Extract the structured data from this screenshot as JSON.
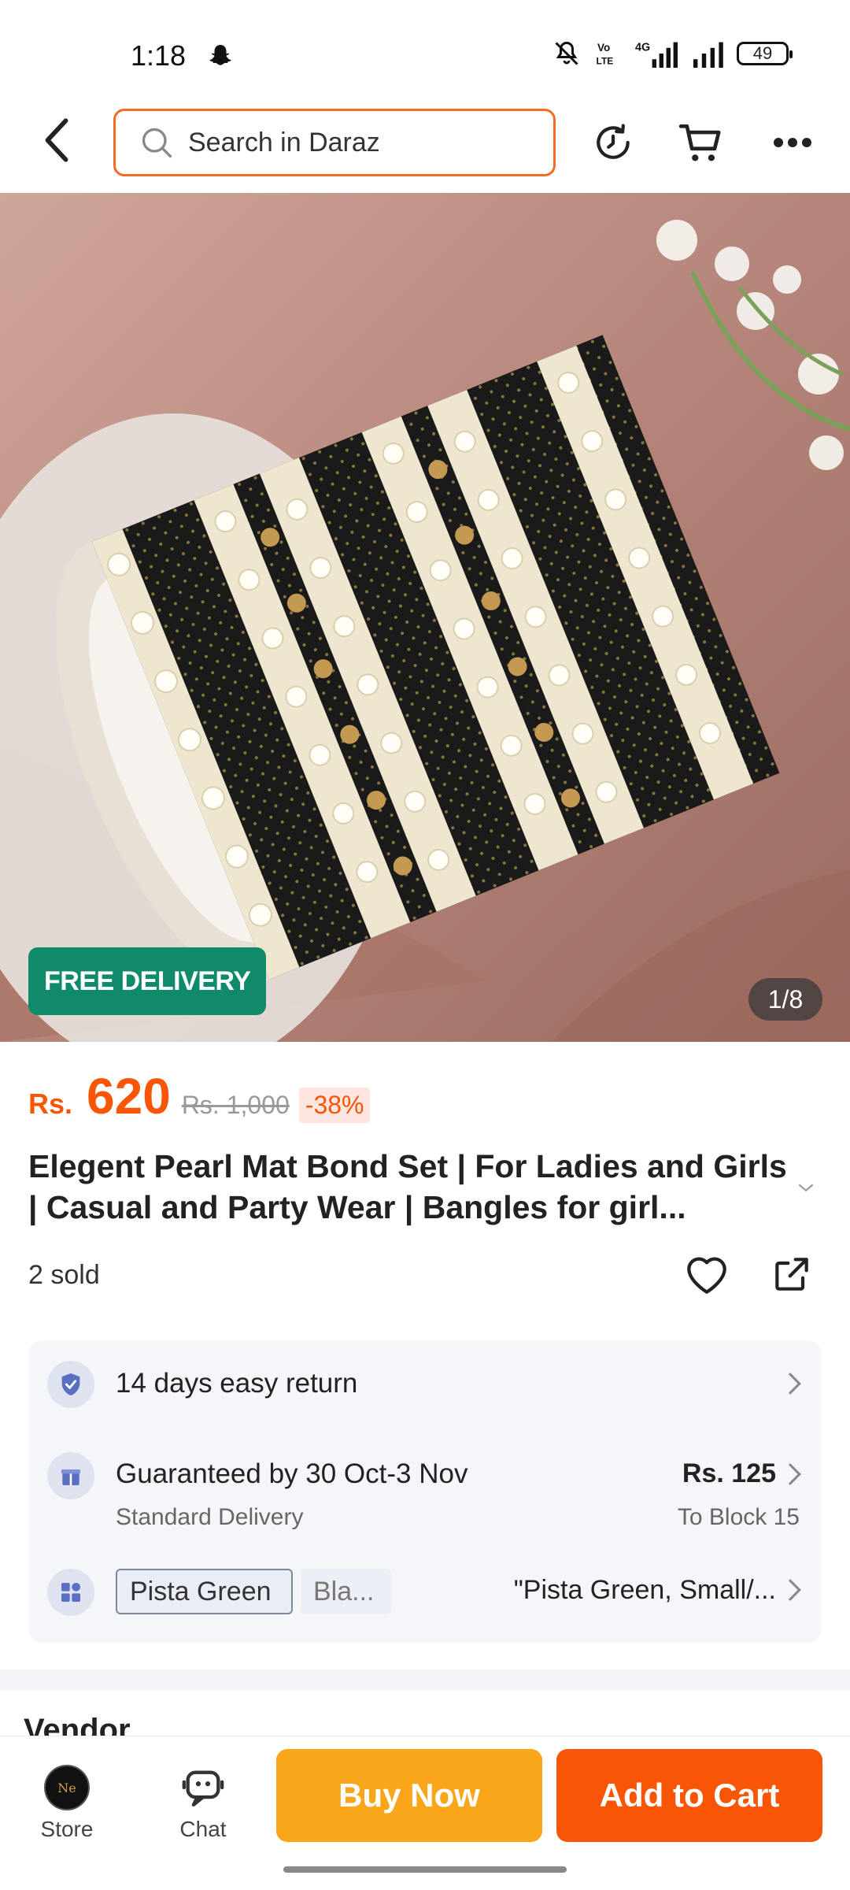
{
  "status_bar": {
    "time": "1:18",
    "battery": "49",
    "icons": [
      "snapchat-icon",
      "mute-icon",
      "volte-icon",
      "signal-4g-icon",
      "signal-icon",
      "battery-icon"
    ]
  },
  "header": {
    "search_placeholder": "Search in Daraz",
    "icons": [
      "back-icon",
      "search-icon",
      "history-icon",
      "cart-icon",
      "more-icon"
    ],
    "accent_color": "#f36c21"
  },
  "gallery": {
    "badge": "FREE DELIVERY",
    "counter": "1/8",
    "current_index": 1,
    "total": 8
  },
  "product": {
    "currency": "Rs.",
    "price": "620",
    "original_price": "Rs. 1,000",
    "discount": "-38%",
    "title": "Elegent Pearl Mat Bond Set | For Ladies and Girls | Casual and Party Wear | Bangles for girl...",
    "sold": "2 sold"
  },
  "info": {
    "return": {
      "label": "14 days easy return"
    },
    "delivery": {
      "label": "Guaranteed by 30 Oct-3 Nov",
      "sub": "Standard Delivery",
      "price": "Rs. 125",
      "location": "To Block 15"
    },
    "variant": {
      "chips": [
        "Pista Green",
        "Bla..."
      ],
      "selected": "\"Pista Green, Small/..."
    }
  },
  "section_peek": "Vendor",
  "bottom_bar": {
    "store_label": "Store",
    "chat_label": "Chat",
    "buy_now": "Buy Now",
    "add_to_cart": "Add to Cart",
    "buy_color": "#faa61a",
    "cart_color": "#f85606"
  },
  "colors": {
    "price": "#f85606",
    "free_delivery_bg": "#0f8a6a"
  }
}
